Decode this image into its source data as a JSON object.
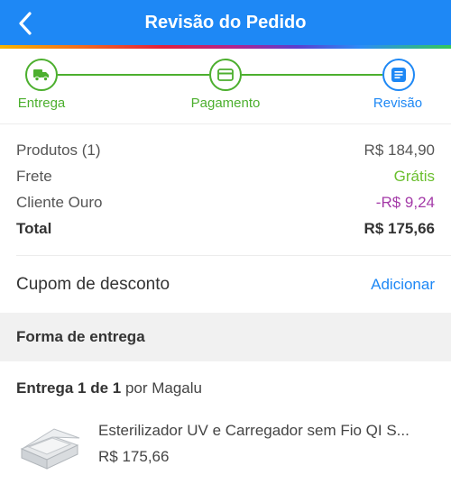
{
  "header": {
    "title": "Revisão do Pedido",
    "back_icon": "chevron-left-icon"
  },
  "colors": {
    "primary": "#1e88f5",
    "success": "#4caf2e",
    "free": "#6abf2e",
    "gold_discount": "#a43ba8"
  },
  "stepper": {
    "steps": [
      {
        "label": "Entrega",
        "icon": "truck-icon",
        "state": "done"
      },
      {
        "label": "Pagamento",
        "icon": "credit-card-icon",
        "state": "done"
      },
      {
        "label": "Revisão",
        "icon": "document-icon",
        "state": "active"
      }
    ]
  },
  "summary": {
    "products_label": "Produtos (1)",
    "products_value": "R$ 184,90",
    "shipping_label": "Frete",
    "shipping_value": "Grátis",
    "gold_label": "Cliente Ouro",
    "gold_value": "-R$ 9,24",
    "total_label": "Total",
    "total_value": "R$ 175,66"
  },
  "coupon": {
    "label": "Cupom de desconto",
    "action": "Adicionar"
  },
  "delivery_section": {
    "title": "Forma de entrega"
  },
  "delivery": {
    "count_text": "Entrega 1 de 1",
    "seller_text": " por Magalu"
  },
  "product": {
    "name": "Esterilizador UV e Carregador sem Fio QI S...",
    "price": "R$ 175,66",
    "image_icon": "uv-sterilizer-case-image"
  }
}
